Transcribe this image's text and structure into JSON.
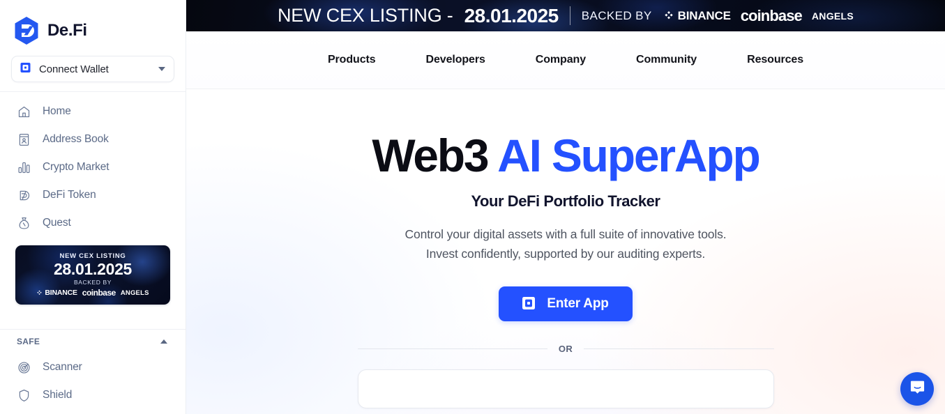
{
  "sidebar": {
    "brand": {
      "name": "De.Fi",
      "logo_icon": "defi-hexagon-logo"
    },
    "connect_wallet": {
      "label": "Connect Wallet",
      "icon": "wallet-icon",
      "caret": "chevron-down-icon"
    },
    "nav_items": [
      {
        "label": "Home",
        "icon": "home-icon"
      },
      {
        "label": "Address Book",
        "icon": "address-book-icon"
      },
      {
        "label": "Crypto Market",
        "icon": "bar-chart-icon"
      },
      {
        "label": "DeFi Token",
        "icon": "defi-token-icon"
      },
      {
        "label": "Quest",
        "icon": "money-bag-icon"
      }
    ],
    "promo": {
      "top_label": "NEW CEX LISTING",
      "date": "28.01.2025",
      "backed_by": "BACKED BY",
      "partners": [
        "BINANCE",
        "coinbase",
        "ANGELS"
      ]
    },
    "safe_section": {
      "title": "SAFE",
      "collapse_icon": "chevron-up-icon",
      "items": [
        {
          "label": "Scanner",
          "icon": "radar-icon"
        },
        {
          "label": "Shield",
          "icon": "shield-icon"
        }
      ]
    }
  },
  "banner": {
    "title": "NEW CEX LISTING -",
    "date": "28.01.2025",
    "backed_by": "BACKED BY",
    "partners": [
      "BINANCE",
      "coinbase",
      "ANGELS"
    ]
  },
  "top_nav": {
    "links": [
      {
        "label": "Products"
      },
      {
        "label": "Developers"
      },
      {
        "label": "Company"
      },
      {
        "label": "Community"
      },
      {
        "label": "Resources"
      }
    ]
  },
  "hero": {
    "title_plain": "Web3 ",
    "title_accent": "AI SuperApp",
    "subtitle": "Your DeFi Portfolio Tracker",
    "description_line1": "Control your digital assets with a full suite of innovative tools.",
    "description_line2": "Invest confidently, supported by our auditing experts.",
    "cta_label": "Enter App",
    "cta_icon": "wallet-icon",
    "or_label": "OR",
    "search_placeholder": ""
  },
  "chat": {
    "icon": "intercom-chat-icon"
  },
  "colors": {
    "accent_blue": "#2451ff",
    "brand_blue": "#1b54e8",
    "text_dark": "#0b0c14",
    "text_muted": "#5b6a87",
    "banner_dark": "#070c1d"
  }
}
